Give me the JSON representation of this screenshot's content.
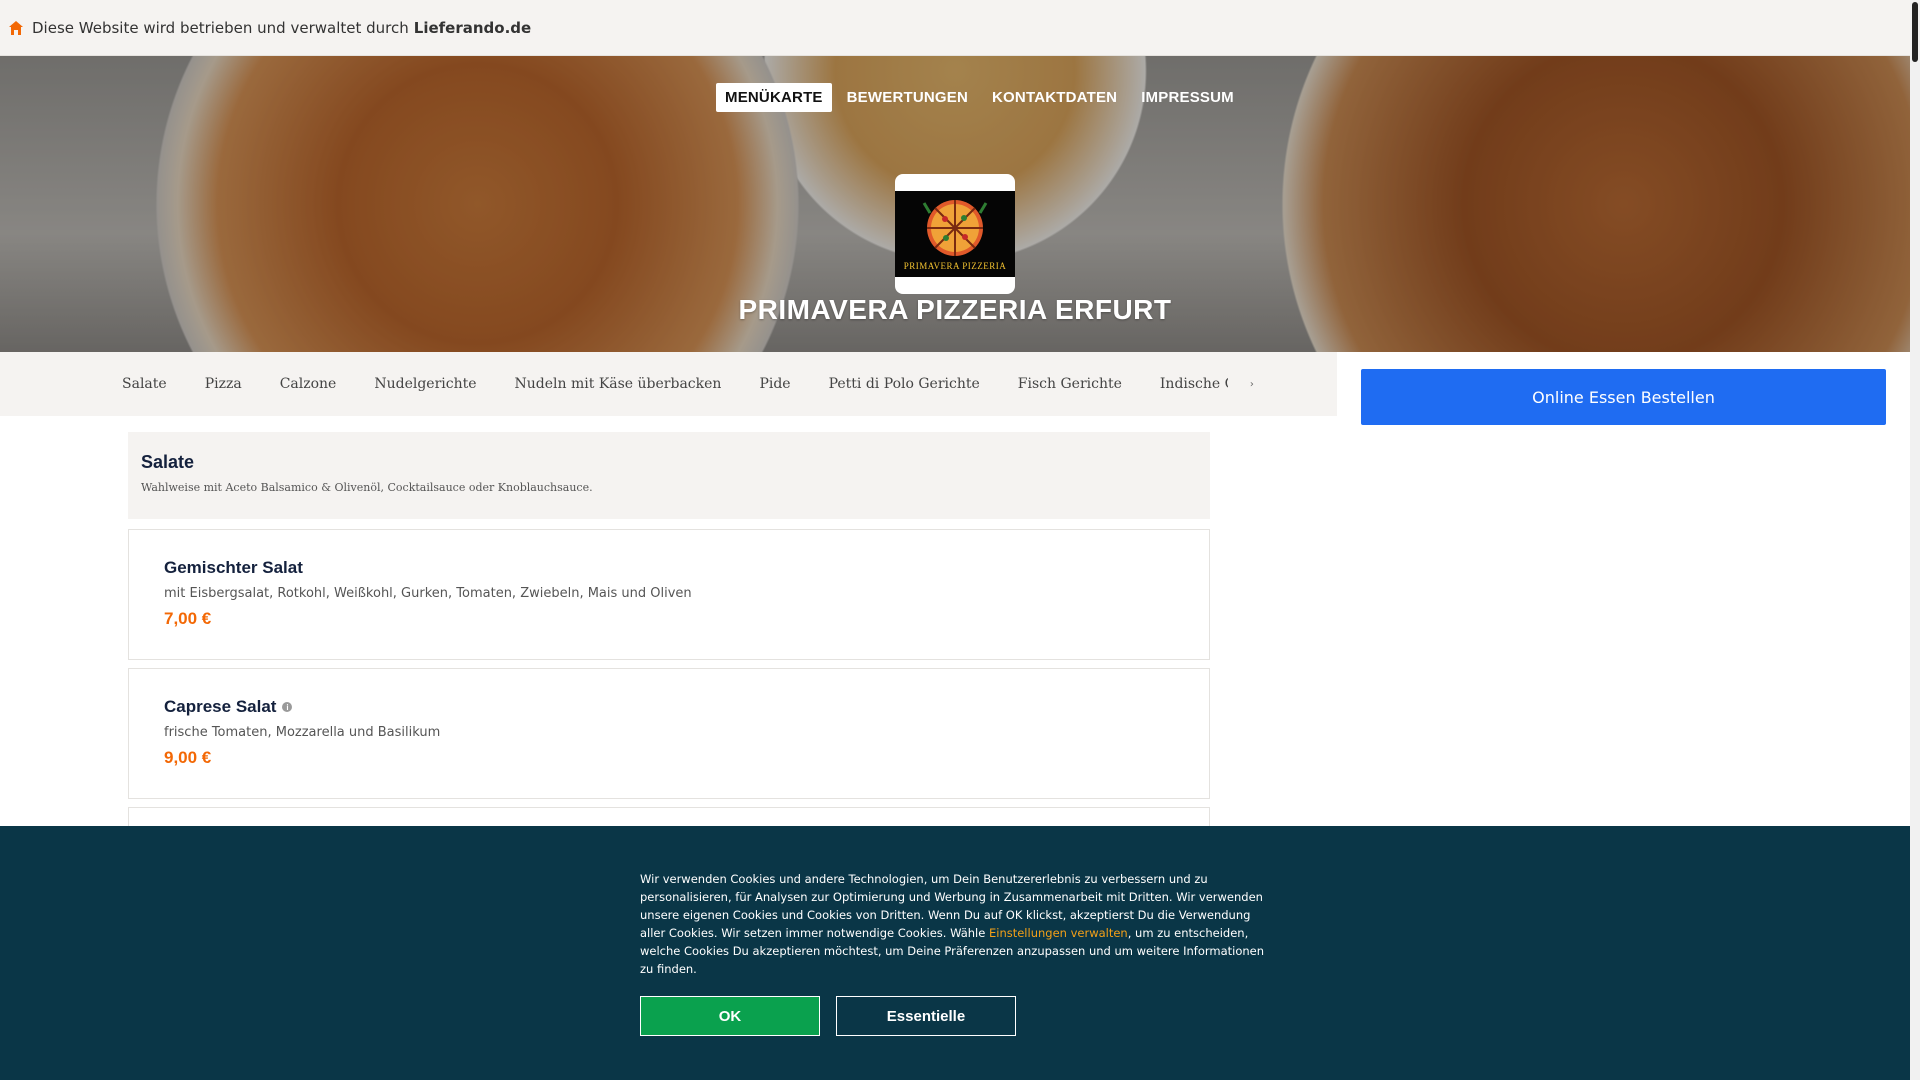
{
  "topbar": {
    "text": "Diese Website wird betrieben und verwaltet durch",
    "brand": "Lieferando.de",
    "icon": "house-icon"
  },
  "nav": {
    "items": [
      "MENÜKARTE",
      "BEWERTUNGEN",
      "KONTAKTDATEN",
      "IMPRESSUM"
    ],
    "active_index": 0
  },
  "restaurant": {
    "logo_caption": "PRIMAVERA PIZZERIA",
    "name": "PRIMAVERA PIZZERIA ERFURT"
  },
  "categories": {
    "items": [
      "Salate",
      "Pizza",
      "Calzone",
      "Nudelgerichte",
      "Nudeln mit Käse überbacken",
      "Pide",
      "Petti di Polo Gerichte",
      "Fisch Gerichte",
      "Indische G"
    ],
    "more_icon": "chevron-right-icon"
  },
  "order_button": "Online Essen Bestellen",
  "section": {
    "title": "Salate",
    "description": "Wahlweise mit Aceto Balsamico & Olivenöl, Cocktailsauce oder Knoblauchsauce."
  },
  "dishes": [
    {
      "name": "Gemischter Salat",
      "description": "mit Eisbergsalat, Rotkohl, Weißkohl, Gurken, Tomaten, Zwiebeln, Mais und Oliven",
      "price": "7,00 €",
      "info_icon": false
    },
    {
      "name": "Caprese Salat",
      "description": "frische Tomaten, Mozzarella und Basilikum",
      "price": "9,00 €",
      "info_icon": true
    }
  ],
  "cookie": {
    "text_before": "Wir verwenden Cookies und andere Technologien, um Dein Benutzererlebnis zu verbessern und zu personalisieren, für Analysen zur Optimierung und Werbung in Zusammenarbeit mit Dritten. Wir verwenden unsere eigenen Cookies und Cookies von Dritten. Wenn Du auf OK klickst, akzeptierst Du die Verwendung aller Cookies. Wir setzen immer notwendige Cookies. Wähle ",
    "link": "Einstellungen verwalten",
    "text_after": ", um zu entscheiden, welche Cookies Du akzeptieren möchtest, um Deine Präferenzen anzupassen und um weitere Informationen zu finden.",
    "ok": "OK",
    "essential": "Essentielle"
  },
  "colors": {
    "accent_blue": "#1f6cf2",
    "price_orange": "#f36805",
    "cookie_bg": "#0a3647",
    "ok_green": "#0aa14e"
  }
}
